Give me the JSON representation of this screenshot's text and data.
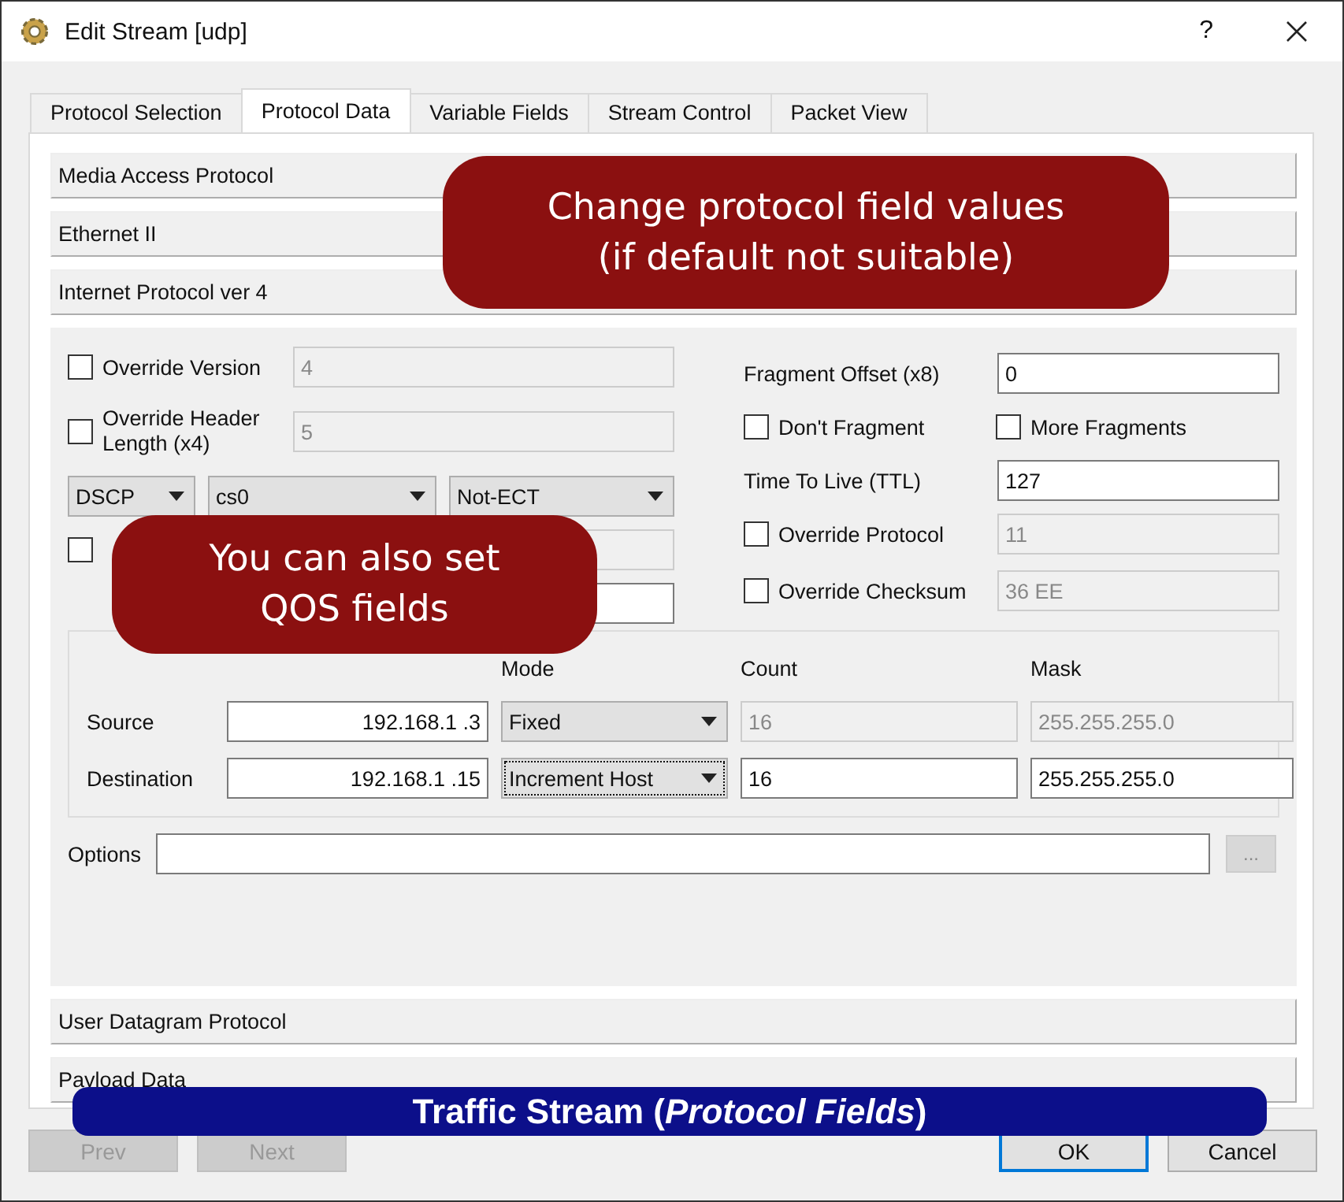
{
  "window": {
    "title": "Edit Stream [udp]",
    "help": "?"
  },
  "tabs": [
    {
      "label": "Protocol Selection",
      "selected": false
    },
    {
      "label": "Protocol Data",
      "selected": true
    },
    {
      "label": "Variable Fields",
      "selected": false
    },
    {
      "label": "Stream Control",
      "selected": false
    },
    {
      "label": "Packet View",
      "selected": false
    }
  ],
  "sections_top": [
    {
      "label": "Media Access Protocol"
    },
    {
      "label": "Ethernet II"
    },
    {
      "label": "Internet Protocol ver 4"
    }
  ],
  "ipv4": {
    "override_version": {
      "label": "Override Version",
      "checked": false,
      "value": "4"
    },
    "override_header_length": {
      "label": "Override Header Length (x4)",
      "checked": false,
      "value": "5"
    },
    "tos": [
      {
        "value": "DSCP"
      },
      {
        "value": "cs0"
      },
      {
        "value": "Not-ECT"
      }
    ],
    "override_length": {
      "checked": false
    },
    "fragment_offset": {
      "label": "Fragment Offset (x8)",
      "value": "0"
    },
    "dont_fragment": {
      "label": "Don't Fragment",
      "checked": false
    },
    "more_fragments": {
      "label": "More Fragments",
      "checked": false
    },
    "ttl": {
      "label": "Time To Live (TTL)",
      "value": "127"
    },
    "override_protocol": {
      "label": "Override Protocol",
      "checked": false,
      "value": "11"
    },
    "override_checksum": {
      "label": "Override Checksum",
      "checked": false,
      "value": "36 EE"
    },
    "addresses": {
      "columns": [
        "Mode",
        "Count",
        "Mask"
      ],
      "rows": [
        {
          "label": "Source",
          "address": "192.168.1  .3",
          "mode": "Fixed",
          "count": "16",
          "mask": "255.255.255.0",
          "disabled": true,
          "focused": false
        },
        {
          "label": "Destination",
          "address": "192.168.1  .15",
          "mode": "Increment Host",
          "count": "16",
          "mask": "255.255.255.0",
          "disabled": false,
          "focused": true
        }
      ]
    },
    "options": {
      "label": "Options",
      "button": "...",
      "button_disabled": true
    }
  },
  "sections_bottom": [
    {
      "label": "User Datagram Protocol"
    },
    {
      "label": "Payload Data"
    }
  ],
  "buttons": [
    {
      "label": "Prev",
      "disabled": true,
      "default": false
    },
    {
      "label": "Next",
      "disabled": true,
      "default": false
    },
    {
      "label": "OK",
      "disabled": false,
      "default": true
    },
    {
      "label": "Cancel",
      "disabled": false,
      "default": false
    }
  ],
  "callouts": [
    {
      "text": "Change protocol field values\n(if default not suitable)"
    },
    {
      "text": "You can also set\nQOS fields"
    }
  ],
  "banner": {
    "text": "Traffic Stream (*Protocol Fields*)"
  }
}
